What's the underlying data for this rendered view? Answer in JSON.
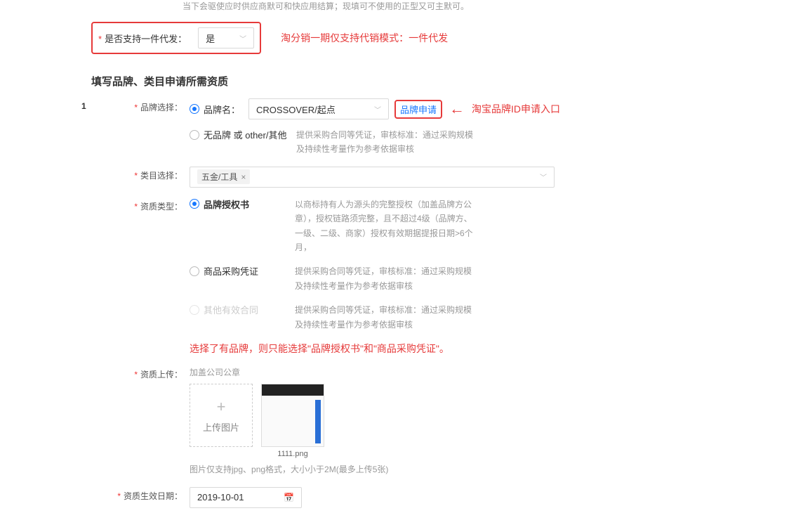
{
  "top_truncated": "当下会驱使应时供应商默可和快应用结算；现填可不使用的正型又可主默可。",
  "supportRow": {
    "label": "是否支持一件代发：",
    "value": "是",
    "annotation": "淘分销一期仅支持代销模式：一件代发"
  },
  "sectionTitle": "填写品牌、类目申请所需资质",
  "brand": {
    "index": "1",
    "label": "品牌选择：",
    "radioBrandName": "品牌名：",
    "selectValue": "CROSSOVER/起点",
    "applyLink": "品牌申请",
    "applyAnnotation": "淘宝品牌ID申请入口",
    "radioNoBrand": "无品牌 或 other/其他",
    "noBrandHelper": "提供采购合同等凭证，审核标准：通过采购规模及持续性考量作为参考依据审核"
  },
  "category": {
    "label": "类目选择：",
    "tag": "五金/工具"
  },
  "qualType": {
    "label": "资质类型：",
    "options": [
      {
        "name": "品牌授权书",
        "checked": true,
        "disabled": false,
        "helper": "以商标持有人为源头的完整授权（加盖品牌方公章），授权链路须完整，且不超过4级（品牌方、一级、二级、商家）授权有效期据提报日期>6个月，"
      },
      {
        "name": "商品采购凭证",
        "checked": false,
        "disabled": false,
        "helper": "提供采购合同等凭证，审核标准：通过采购规模及持续性考量作为参考依据审核"
      },
      {
        "name": "其他有效合同",
        "checked": false,
        "disabled": true,
        "helper": "提供采购合同等凭证，审核标准：通过采购规模及持续性考量作为参考依据审核"
      }
    ],
    "note": "选择了有品牌，则只能选择\"品牌授权书\"和\"商品采购凭证\"。"
  },
  "upload": {
    "label": "资质上传：",
    "hint": "加盖公司公章",
    "btn": "上传图片",
    "thumbName": "1111.png",
    "helper": "图片仅支持jpg、png格式，大小小于2M(最多上传5张)"
  },
  "effectDate": {
    "label": "资质生效日期：",
    "value": "2019-10-01"
  }
}
